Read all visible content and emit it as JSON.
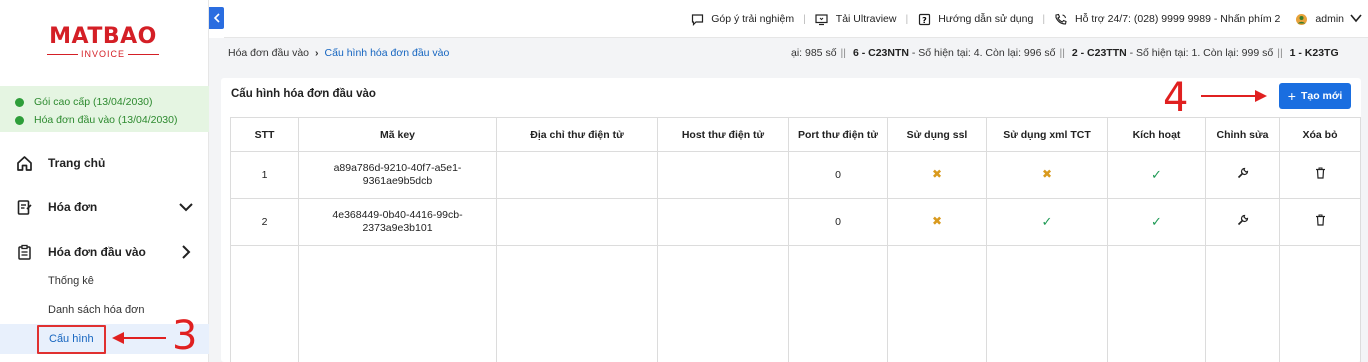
{
  "logo": {
    "main": "MATBAO",
    "sub": "INVOICE"
  },
  "plans": [
    {
      "label": "Gói cao cấp (13/04/2030)"
    },
    {
      "label": "Hóa đơn đầu vào (13/04/2030)"
    }
  ],
  "sidebar": {
    "home": "Trang chủ",
    "invoices": "Hóa đơn",
    "input_invoices": "Hóa đơn đầu vào",
    "sub": {
      "stats": "Thống kê",
      "list": "Danh sách hóa đơn",
      "config": "Cấu hình"
    }
  },
  "topbar": {
    "feedback": "Góp ý trải nghiệm",
    "ultraview": "Tải Ultraview",
    "guide": "Hướng dẫn sử dụng",
    "support": "Hỗ trợ 24/7: (028) 9999 9989 - Nhấn phím 2",
    "user": "admin"
  },
  "breadcrumb": {
    "parent": "Hóa đơn đầu vào",
    "current": "Cấu hình hóa đơn đầu vào"
  },
  "ticker": {
    "part1": "ại: 985 số",
    "code2": "6 - C23NTN",
    "part2": "- Số hiện tại: 4. Còn lại: 996 số",
    "code3": "2 - C23TTN",
    "part3": "- Số hiện tại: 1. Còn lại: 999 số",
    "code4": "1 - K23TG"
  },
  "card": {
    "title": "Cấu hình hóa đơn đầu vào",
    "create_label": "Tạo mới"
  },
  "table": {
    "headers": [
      "STT",
      "Mã key",
      "Địa chỉ thư điện tử",
      "Host thư điện tử",
      "Port thư điện tử",
      "Sử dụng ssl",
      "Sử dụng xml TCT",
      "Kích hoạt",
      "Chỉnh sửa",
      "Xóa bỏ"
    ],
    "rows": [
      {
        "stt": "1",
        "key_line1": "a89a786d-9210-40f7-a5e1-",
        "key_line2": "9361ae9b5dcb",
        "email": "",
        "host": "",
        "port": "0",
        "ssl": "x",
        "xml": "x",
        "active": "check"
      },
      {
        "stt": "2",
        "key_line1": "4e368449-0b40-4416-99cb-",
        "key_line2": "2373a9e3b101",
        "email": "",
        "host": "",
        "port": "0",
        "ssl": "x",
        "xml": "check",
        "active": "check"
      }
    ]
  },
  "annotations": {
    "step3": "3",
    "step4": "4"
  },
  "colors": {
    "brand_red": "#d41f26",
    "primary_blue": "#1a6ee0",
    "success_green": "#1f9a55",
    "warning_orange": "#d99a1e",
    "annotation_red": "#e02020"
  }
}
